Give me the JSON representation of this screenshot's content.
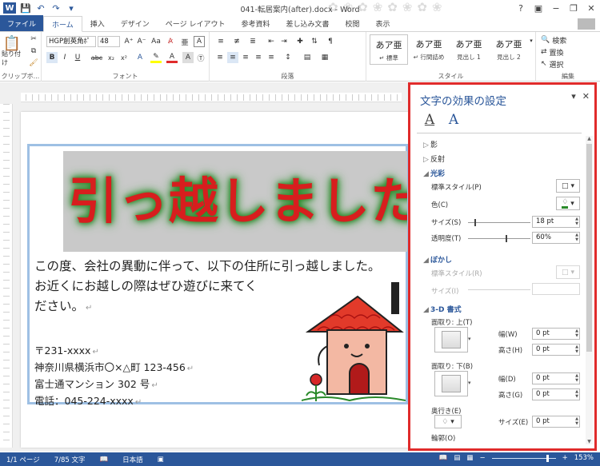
{
  "window": {
    "title": "041-転居案内(after).docx - Word",
    "help": "?",
    "minimize": "−",
    "restore": "❐",
    "close": "✕"
  },
  "qat": {
    "logo": "W",
    "save_icon": "save-icon",
    "undo_icon": "undo-icon",
    "redo_icon": "redo-icon"
  },
  "tabs": [
    "ファイル",
    "ホーム",
    "挿入",
    "デザイン",
    "ページ レイアウト",
    "参考資料",
    "差し込み文書",
    "校閲",
    "表示"
  ],
  "ribbon": {
    "clipboard": {
      "paste": "貼り付け",
      "label": "クリップボ..."
    },
    "font": {
      "name": "HGP創英角ﾎﾟ",
      "size": "48",
      "label": "フォント",
      "bold": "B",
      "italic": "I",
      "underline": "U",
      "strike": "abc",
      "sub": "x₂",
      "sup": "x²"
    },
    "paragraph": {
      "label": "段落"
    },
    "styles": {
      "label": "スタイル",
      "items": [
        {
          "preview": "あア亜",
          "name": "↵ 標準"
        },
        {
          "preview": "あア亜",
          "name": "↵ 行間詰め"
        },
        {
          "preview": "あア亜",
          "name": "見出し 1"
        },
        {
          "preview": "あア亜",
          "name": "見出し 2"
        }
      ]
    },
    "editing": {
      "label": "編集",
      "find": "検索",
      "replace": "置換",
      "select": "選択"
    }
  },
  "document": {
    "banner": "引っ越しました",
    "body_lines": [
      "この度、会社の異動に伴って、以下の住所に引っ越しました。",
      "お近くにお越しの際はぜひ遊びに来てく",
      "ださい。"
    ],
    "address_lines": [
      "〒231-xxxx",
      "神奈川県横浜市〇×△町 123-456",
      "富士通マンション 302 号",
      "電話：045-224-xxxx"
    ],
    "pilcrow": "↵"
  },
  "pane": {
    "title": "文字の効果の設定",
    "sections": {
      "shadow": "影",
      "reflection": "反射",
      "glow": "光彩",
      "soft_edges": "ぼかし",
      "format_3d": "3-D 書式"
    },
    "glow": {
      "preset_label": "標準スタイル(P)",
      "color_label": "色(C)",
      "size_label": "サイズ(S)",
      "size_value": "18 pt",
      "size_fraction": 0.1,
      "transparency_label": "透明度(T)",
      "transparency_value": "60%",
      "transparency_fraction": 0.6
    },
    "soft": {
      "preset_label": "標準スタイル(R)",
      "size_label": "サイズ(I)"
    },
    "format3d": {
      "top_bevel": "面取り: 上(T)",
      "width_w": "幅(W)",
      "width_w_value": "0 pt",
      "height_h": "高さ(H)",
      "height_h_value": "0 pt",
      "bottom_bevel": "面取り: 下(B)",
      "width_d": "幅(D)",
      "width_d_value": "0 pt",
      "height_g": "高さ(G)",
      "height_g_value": "0 pt",
      "depth": "奥行き(E)",
      "depth_size": "サイズ(E)",
      "depth_size_value": "0 pt",
      "contour": "輪郭(O)"
    }
  },
  "status": {
    "page": "1/1 ページ",
    "words": "7/85 文字",
    "language": "日本語",
    "zoom": "153%",
    "zoom_fraction": 0.85
  },
  "colors": {
    "accent": "#2b579a",
    "highlight_border": "#e02b2b",
    "banner_text": "#d71e1e",
    "glow": "#2a8a2a"
  }
}
